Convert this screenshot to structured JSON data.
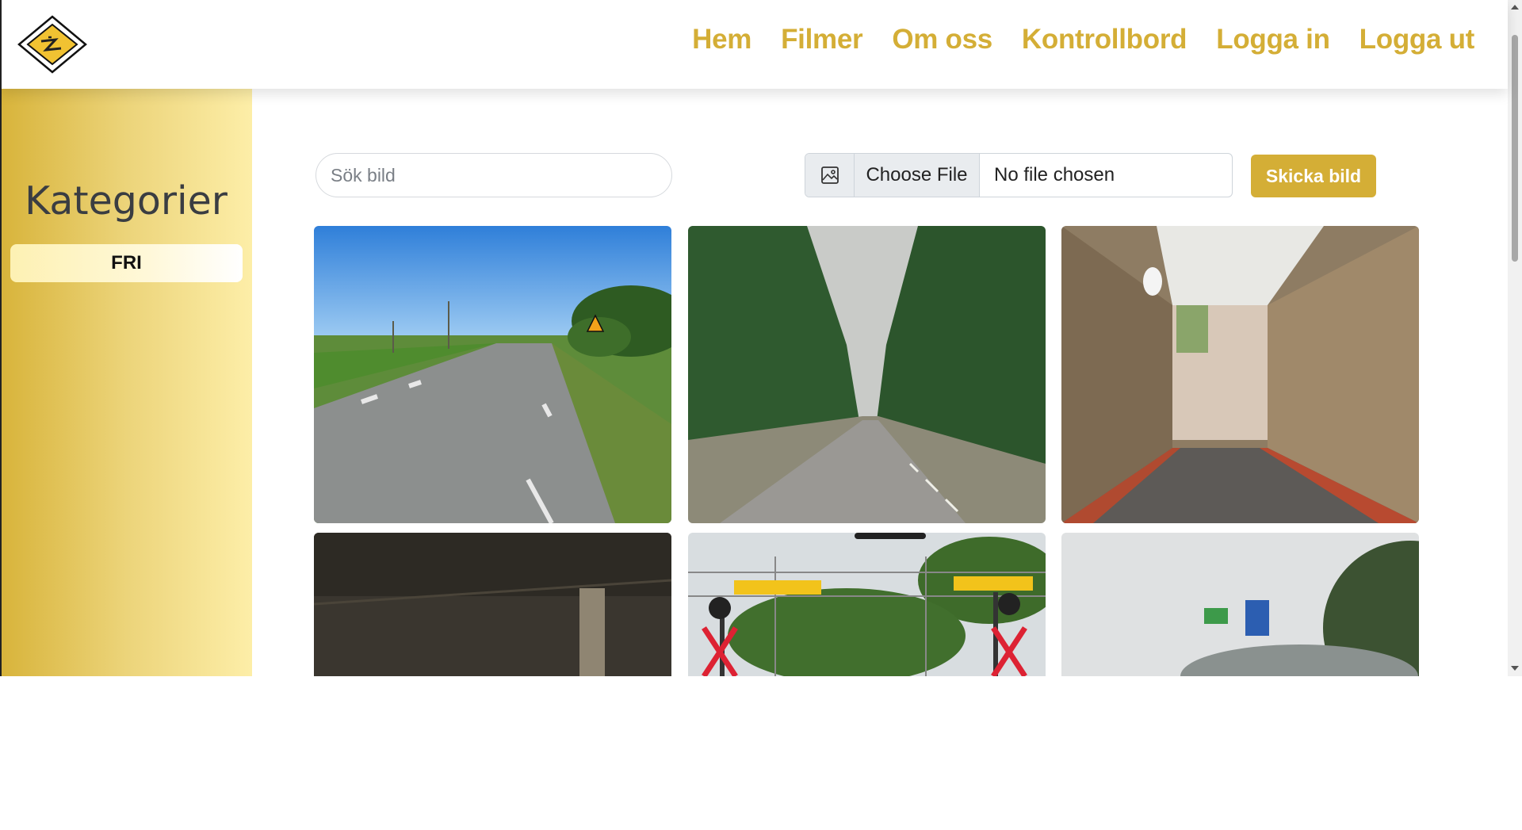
{
  "nav": {
    "logo_icon": "road-sign-diamond-icon",
    "links": [
      "Hem",
      "Filmer",
      "Om oss",
      "Kontrollbord",
      "Logga in",
      "Logga ut"
    ],
    "accent_color": "#d4ae36"
  },
  "sidebar": {
    "title": "Kategorier",
    "categories": [
      "FRI"
    ]
  },
  "toolbar": {
    "search_placeholder": "Sök bild",
    "file_icon": "image-icon",
    "choose_file_label": "Choose File",
    "file_status": "No file chosen",
    "send_label": "Skicka bild"
  },
  "gallery": {
    "images": [
      {
        "subject": "road-sunny-field"
      },
      {
        "subject": "road-forest"
      },
      {
        "subject": "tunnel-passage"
      },
      {
        "subject": "dark-wet-ground"
      },
      {
        "subject": "railway-crossing-signs"
      },
      {
        "subject": "blurred-rain-street"
      }
    ]
  }
}
